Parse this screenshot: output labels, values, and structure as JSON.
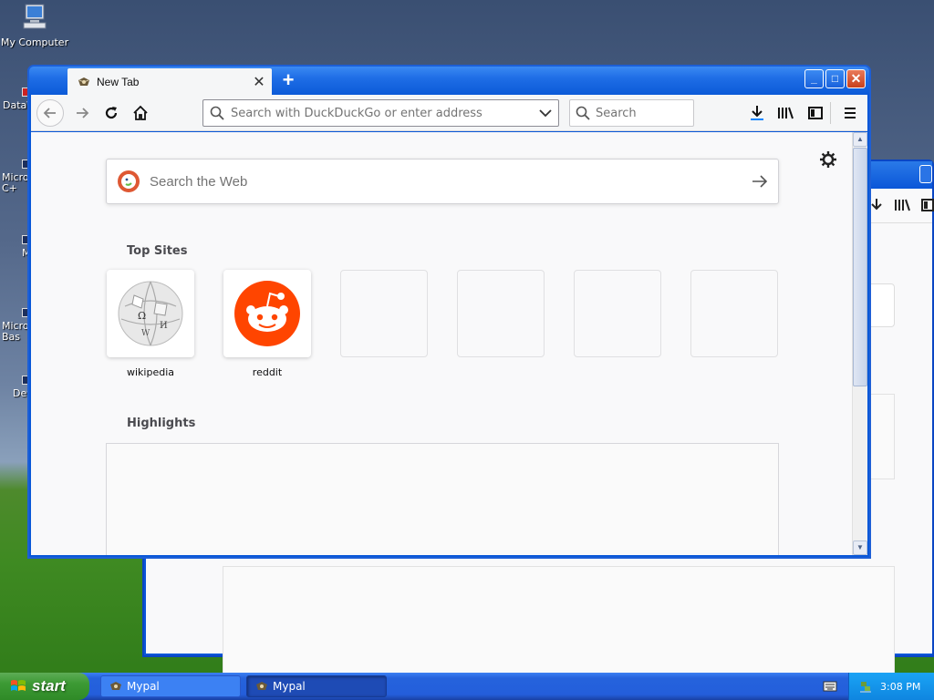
{
  "desktop": {
    "icons": [
      {
        "label": "My Computer"
      },
      {
        "label": "DataV"
      },
      {
        "label": "Micros\nC+"
      },
      {
        "label": "M"
      },
      {
        "label": "Micros\nBas"
      },
      {
        "label": "Dev"
      }
    ]
  },
  "browser": {
    "tab_label": "New Tab",
    "url_placeholder": "Search with DuckDuckGo or enter address",
    "search_placeholder": "Search",
    "web_search_placeholder": "Search the Web",
    "top_sites_title": "Top Sites",
    "highlights_title": "Highlights",
    "top_sites": [
      {
        "label": "wikipedia"
      },
      {
        "label": "reddit"
      },
      {
        "label": ""
      },
      {
        "label": ""
      },
      {
        "label": ""
      },
      {
        "label": ""
      }
    ]
  },
  "taskbar": {
    "start_label": "start",
    "tasks": [
      {
        "label": "Mypal"
      },
      {
        "label": "Mypal"
      }
    ],
    "clock": "3:08 PM"
  },
  "colors": {
    "titlebar": "#0b5ad8",
    "start_green": "#3c9a34",
    "reddit_orange": "#ff4500"
  }
}
